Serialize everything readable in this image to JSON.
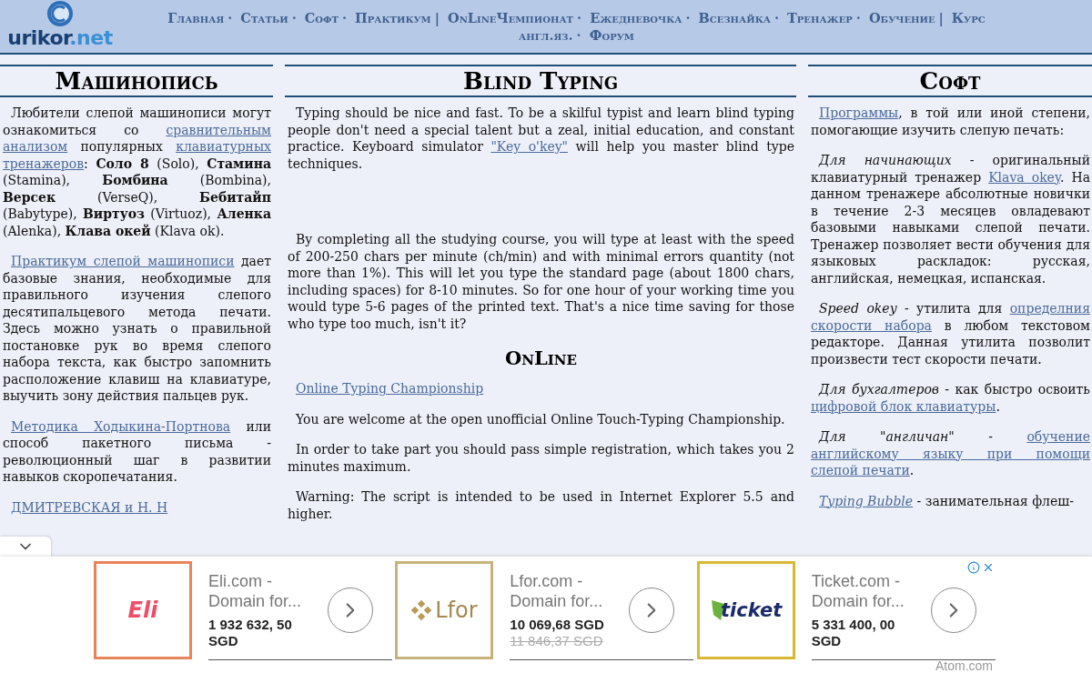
{
  "header": {
    "logo": {
      "name": "urikor",
      "suffix": ".net"
    },
    "nav": [
      {
        "label": "Главная",
        "separator": "·"
      },
      {
        "label": "Статьи",
        "separator": "·"
      },
      {
        "label": "Софт",
        "separator": "·"
      },
      {
        "label": "Практикум",
        "separator": "|"
      },
      {
        "label": "OnLineЧемпионат",
        "separator": "·"
      },
      {
        "label": "Ежедневочка",
        "separator": "·"
      },
      {
        "label": "Всезнайка",
        "separator": "·"
      },
      {
        "label": "Тренажер",
        "separator": "·"
      },
      {
        "label": "Обучение",
        "separator": "|"
      },
      {
        "label": "Курс"
      },
      {
        "label": "англ.яз.",
        "separator": "·"
      },
      {
        "label": "Форум"
      }
    ]
  },
  "columns": [
    {
      "heading": "Машинопись",
      "blocks": [
        {
          "kind": "paragraph",
          "parts": [
            {
              "kind": "text",
              "text": "Любители слепой машинописи могут ознакомиться со "
            },
            {
              "kind": "link",
              "text": "сравнительным"
            },
            {
              "kind": "link",
              "text": "анализом"
            },
            {
              "kind": "text",
              "text": " популярных "
            },
            {
              "kind": "link",
              "text": "клавиатурных"
            },
            {
              "kind": "link",
              "text": "тренажеров"
            },
            {
              "kind": "text",
              "text": ": **Соло 8** (Solo), **Стамина** (Stamina), **Бомбина** (Bombina), **Версек** (VerseQ), **Бебитайп** (Babytype), **Виртуоз** (Virtuoz), **Аленка** (Alenka), **Клава окей** (Klava ok)."
            }
          ]
        },
        {
          "kind": "paragraph",
          "parts": [
            {
              "kind": "link",
              "text": "Практикум слепой машинописи"
            },
            {
              "kind": "text",
              "text": " дает базовые знания, необходимые для правильного изучения слепого десятипальцевого метода печати. Здесь можно узнать о правильной постановке рук во время слепого набора текста, как быстро запомнить расположение клавиш на клавиатуре, выучить зону действия пальцев рук."
            }
          ]
        },
        {
          "kind": "paragraph",
          "parts": [
            {
              "kind": "link",
              "text": "Методика Ходыкина-Портнова"
            },
            {
              "kind": "text",
              "text": " или способ пакетного письма - революционный шаг в развитии навыков скоропечатания."
            }
          ]
        },
        {
          "kind": "paragraph",
          "parts": [
            {
              "kind": "link",
              "text": "ДМИТРЕВСКАЯ и Н. Н"
            }
          ]
        }
      ]
    },
    {
      "heading": "Blind Typing",
      "blocks": [
        {
          "kind": "paragraph",
          "parts": [
            {
              "kind": "text",
              "text": "Typing should be nice and fast. To be a skilful typist and learn blind typing people don't need a special talent but a zeal, initial education, and constant practice. Keyboard simulator "
            },
            {
              "kind": "link",
              "text": "\"Key o'key\""
            },
            {
              "kind": "text",
              "text": " will help you master blind type techniques."
            }
          ]
        },
        {
          "kind": "spacer"
        },
        {
          "kind": "paragraph",
          "parts": [
            {
              "kind": "text",
              "text": "By completing all the studying course, you will type at least with the speed of 200-250 chars per minute (ch/min) and with minimal errors quantity (not more than 1%). This will let you type the standard page (about 1800 chars, including spaces) for 8-10 minutes. So for one hour of your working time you would type 5-6 pages of the printed text. That's a nice time saving for those who type too much, isn't it?"
            }
          ]
        },
        {
          "kind": "subheading",
          "text": "OnLine"
        },
        {
          "kind": "paragraph",
          "parts": [
            {
              "kind": "link",
              "text": "Online Typing Championship"
            }
          ]
        },
        {
          "kind": "paragraph",
          "parts": [
            {
              "kind": "text",
              "text": "You are welcome at the open unofficial Online Touch-Typing Championship."
            }
          ]
        },
        {
          "kind": "paragraph",
          "parts": [
            {
              "kind": "text",
              "text": "In order to take part you should pass simple registration, which takes you 2 minutes maximum."
            }
          ]
        },
        {
          "kind": "paragraph",
          "parts": [
            {
              "kind": "text",
              "text": "Warning: The script is intended to be used in Internet Explorer 5.5 and higher."
            }
          ]
        }
      ]
    },
    {
      "heading": "Софт",
      "blocks": [
        {
          "kind": "paragraph",
          "parts": [
            {
              "kind": "link",
              "text": "Программы"
            },
            {
              "kind": "text",
              "text": ", в той или иной степени, помогающие изучить слепую печать:"
            }
          ]
        },
        {
          "kind": "paragraph",
          "parts": [
            {
              "kind": "text",
              "text": "*Для начинающих* - оригинальный клавиатурный тренажер "
            },
            {
              "kind": "link",
              "text": "Klava okey"
            },
            {
              "kind": "text",
              "text": ". На данном тренажере абсолютные новички в течение 2-3 месяцев овладевают базовыми навыками слепой печати. Тренажер позволяет вести обучения для языковых раскладок: русская, английская, немецкая, испанская."
            }
          ]
        },
        {
          "kind": "paragraph",
          "parts": [
            {
              "kind": "text",
              "text": "*Speed okey* - утилита для "
            },
            {
              "kind": "link",
              "text": "определния"
            },
            {
              "kind": "link",
              "text": "скорости набора"
            },
            {
              "kind": "text",
              "text": " в любом текстовом редакторе. Данная утилита позволит произвести тест скорости печати."
            }
          ]
        },
        {
          "kind": "paragraph",
          "parts": [
            {
              "kind": "text",
              "text": "*Для бухгалтеров* - как быстро освоить "
            },
            {
              "kind": "link",
              "text": "цифровой блок клавиатуры"
            },
            {
              "kind": "text",
              "text": "."
            }
          ]
        },
        {
          "kind": "paragraph",
          "parts": [
            {
              "kind": "text",
              "text": "*Для \"англичан\"* - "
            },
            {
              "kind": "link",
              "text": "обучение"
            },
            {
              "kind": "link",
              "text": "английскому языку при помощи"
            },
            {
              "kind": "link",
              "text": "слепой печати"
            },
            {
              "kind": "text",
              "text": "."
            }
          ]
        },
        {
          "kind": "paragraph",
          "parts": [
            {
              "kind": "link",
              "text": "*Typing Bubble*"
            },
            {
              "kind": "text",
              "text": " - занимательная флеш-"
            }
          ]
        }
      ]
    }
  ],
  "ads": {
    "footer": "Atom.com",
    "items": [
      {
        "logo": "Eli",
        "kind": "eli",
        "color": "#e8845a",
        "title": "Eli.com - Domain for...",
        "price": "1 932 632, 50 SGD"
      },
      {
        "logo": "Lfor",
        "kind": "lfor",
        "color": "#c8b27c",
        "title": "Lfor.com - Domain for...",
        "price": "10 069,68 SGD",
        "old_price": "11 846,37 SGD"
      },
      {
        "logo": "ticket",
        "kind": "ticket",
        "color": "#d9b934",
        "title": "Ticket.com - Domain for...",
        "price": "5 331 400, 00 SGD"
      }
    ]
  }
}
